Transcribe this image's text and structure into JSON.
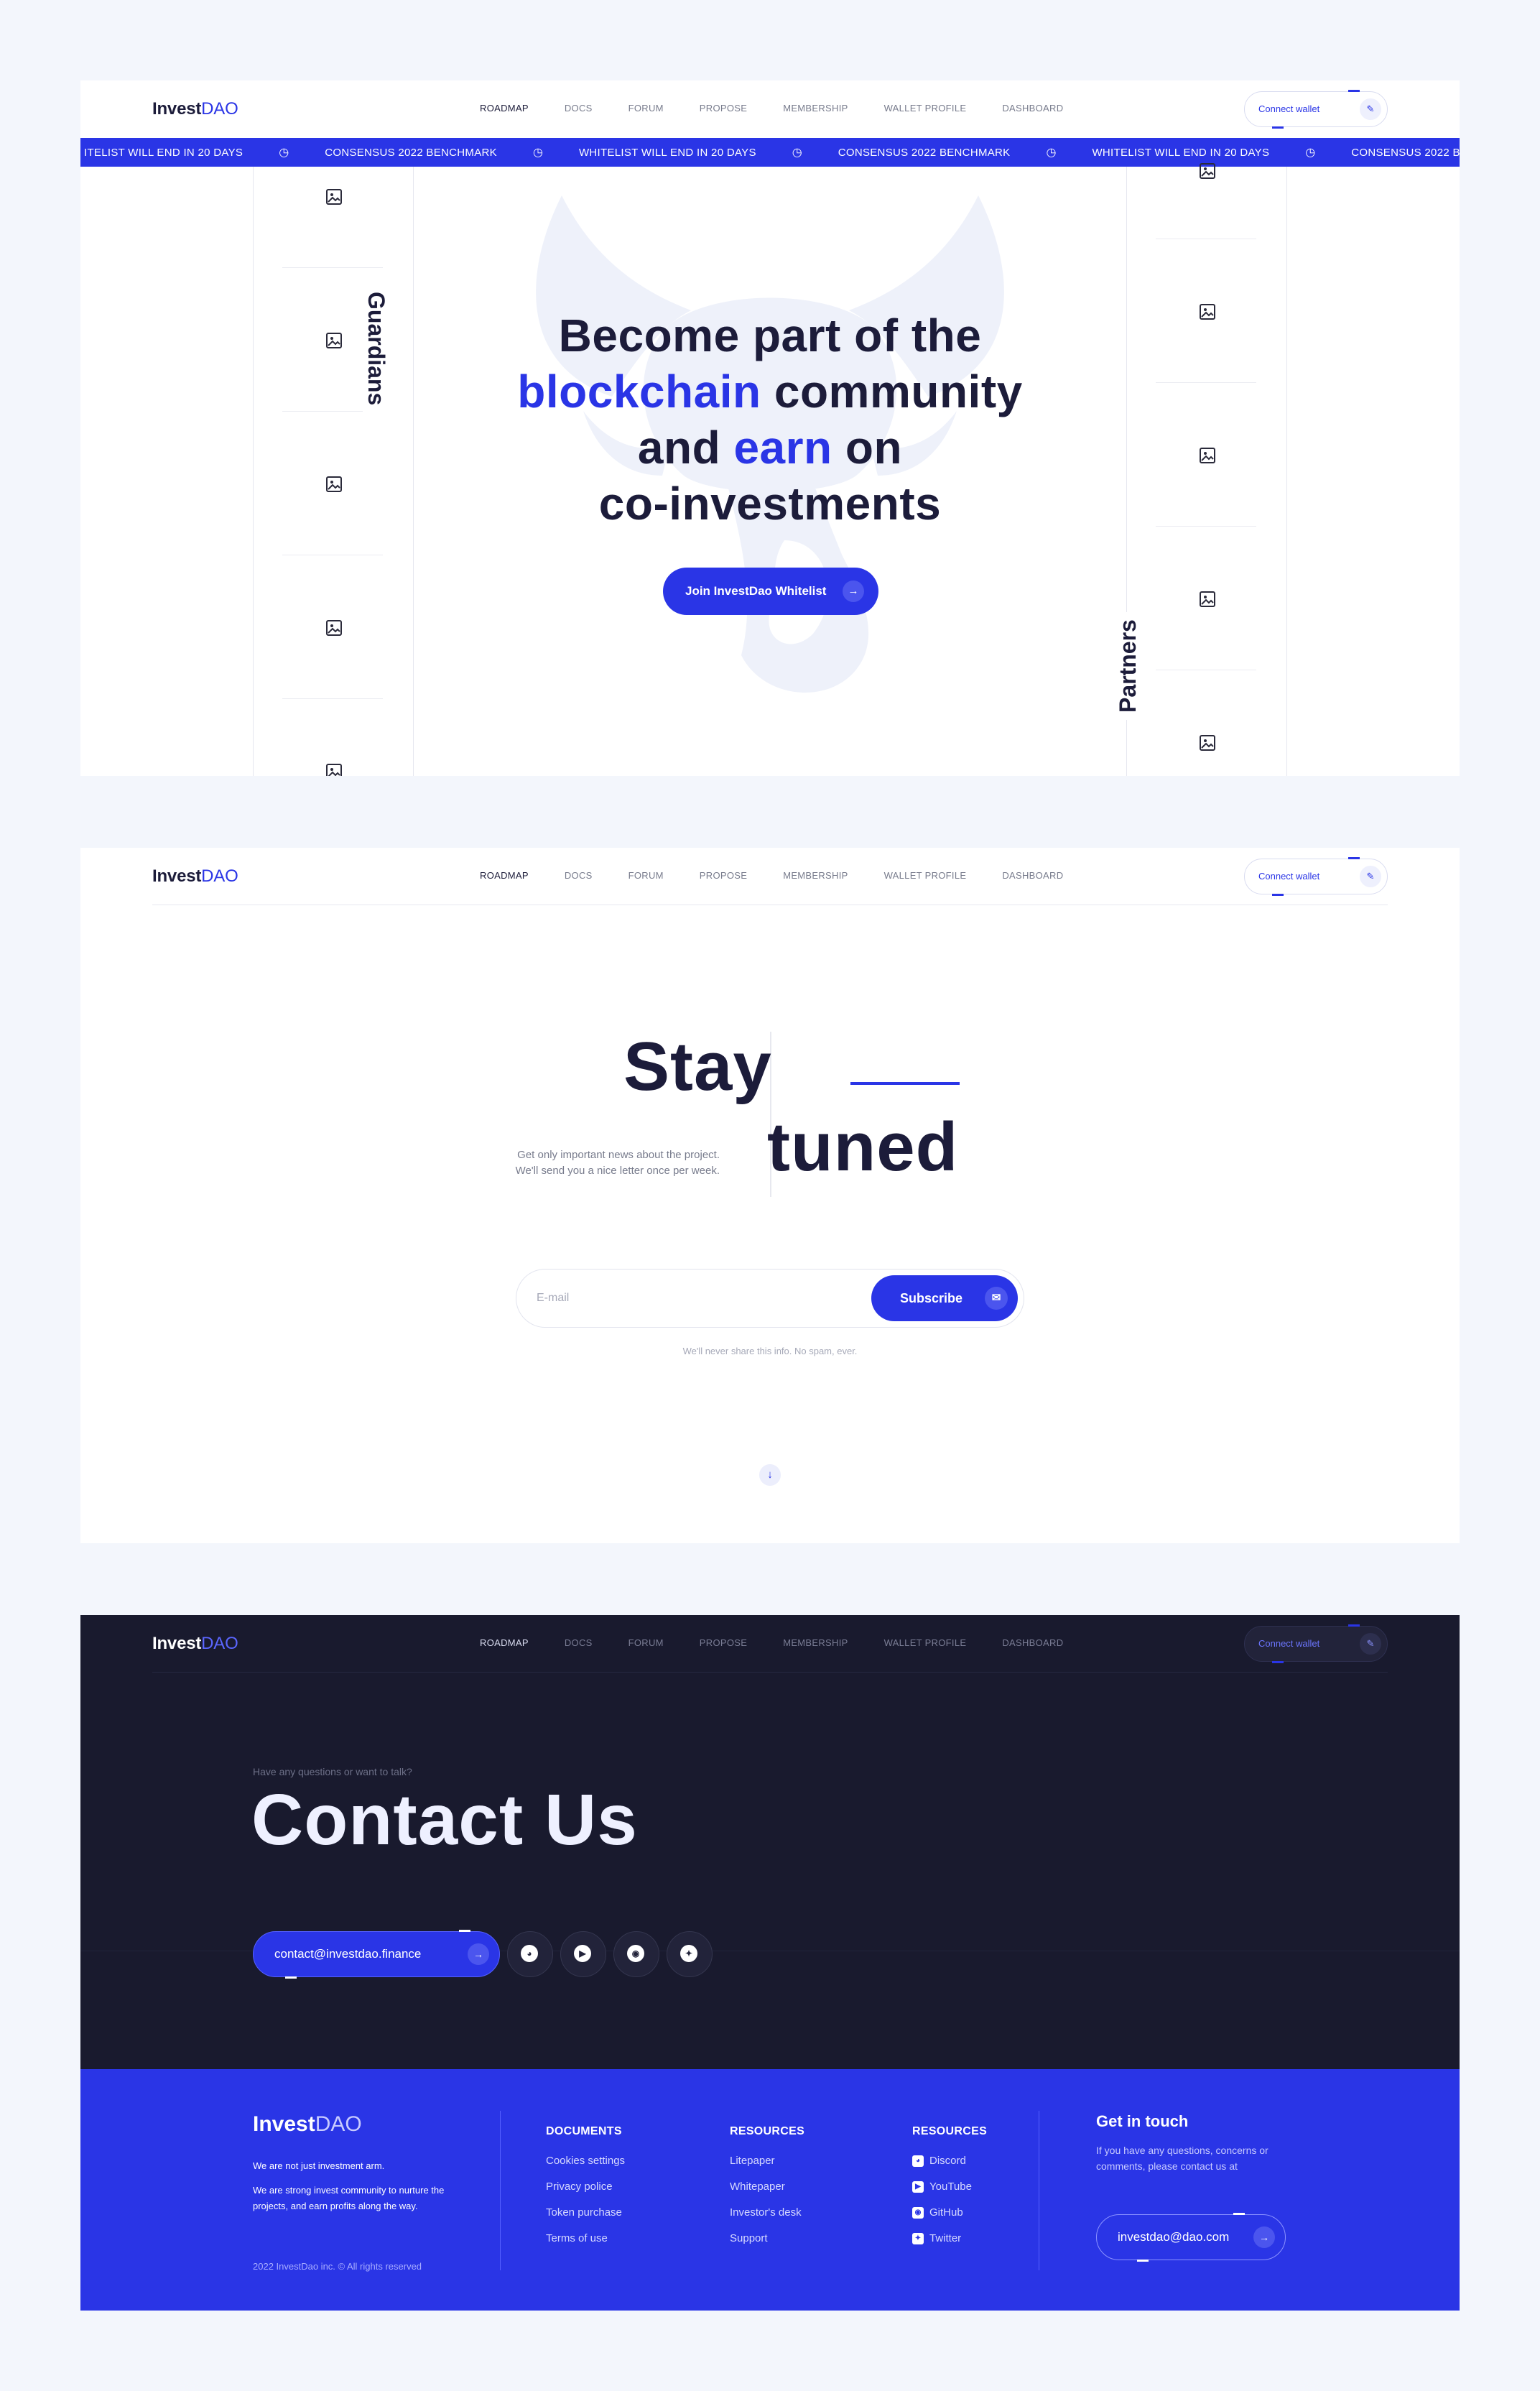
{
  "brand": {
    "name_part1": "Invest",
    "name_part2": "DAO"
  },
  "nav": {
    "items": [
      "ROADMAP",
      "DOCS",
      "FORUM",
      "PROPOSE",
      "MEMBERSHIP",
      "WALLET PROFILE",
      "DASHBOARD"
    ],
    "active": "ROADMAP",
    "connect_wallet": "Connect wallet",
    "connect_icon": "pen-icon"
  },
  "ticker": {
    "items": [
      "ITELIST WILL END IN 20 DAYS",
      "CONSENSUS 2022 BENCHMARK",
      "WHITELIST WILL END IN 20 DAYS",
      "CONSENSUS 2022 BENCHMARK",
      "WHITELIST WILL END IN 20 DAYS",
      "CONSENSUS 2022 B"
    ]
  },
  "hero": {
    "guardians_label": "Guardians",
    "partners_label": "Partners",
    "title_line1": "Become part of the",
    "title_line2_accent": "blockchain",
    "title_line2_rest": " community",
    "title_line3_a": "and ",
    "title_line3_accent": "earn",
    "title_line3_b": " on",
    "title_line4": "co-investments",
    "cta": "Join InvestDao Whitelist"
  },
  "newsletter": {
    "title_part1": "Stay",
    "title_part2": "tuned",
    "desc_line1": "Get only important news about the project.",
    "desc_line2": "We'll send you a nice letter once per week.",
    "email_placeholder": "E-mail",
    "subscribe": "Subscribe",
    "note": "We'll never share this info. No spam, ever."
  },
  "contact": {
    "kicker": "Have any questions or want to talk?",
    "title": "Contact Us",
    "email": "contact@investdao.finance",
    "socials": [
      "discord-icon",
      "youtube-icon",
      "github-icon",
      "twitter-icon"
    ]
  },
  "footer": {
    "tagline1": "We are not just investment arm.",
    "tagline2": "We are strong invest community to nurture the projects, and earn profits along the way.",
    "copyright": "2022 InvestDao inc. © All rights reserved",
    "col1": {
      "heading": "DOCUMENTS",
      "items": [
        "Cookies settings",
        "Privacy police",
        "Token purchase",
        "Terms of use"
      ]
    },
    "col2": {
      "heading": "RESOURCES",
      "items": [
        "Litepaper",
        "Whitepaper",
        "Investor's desk",
        "Support"
      ]
    },
    "col3": {
      "heading": "RESOURCES",
      "items": [
        "Discord",
        "YouTube",
        "GitHub",
        "Twitter"
      ]
    },
    "touch_heading": "Get in touch",
    "touch_text": "If you have any questions, concerns or comments, please contact us at",
    "touch_email": "investdao@dao.com"
  },
  "colors": {
    "accent": "#2a35e6",
    "dark_bg": "#191a2e",
    "ink": "#1c1c3a",
    "page_bg": "#f3f6fc"
  }
}
